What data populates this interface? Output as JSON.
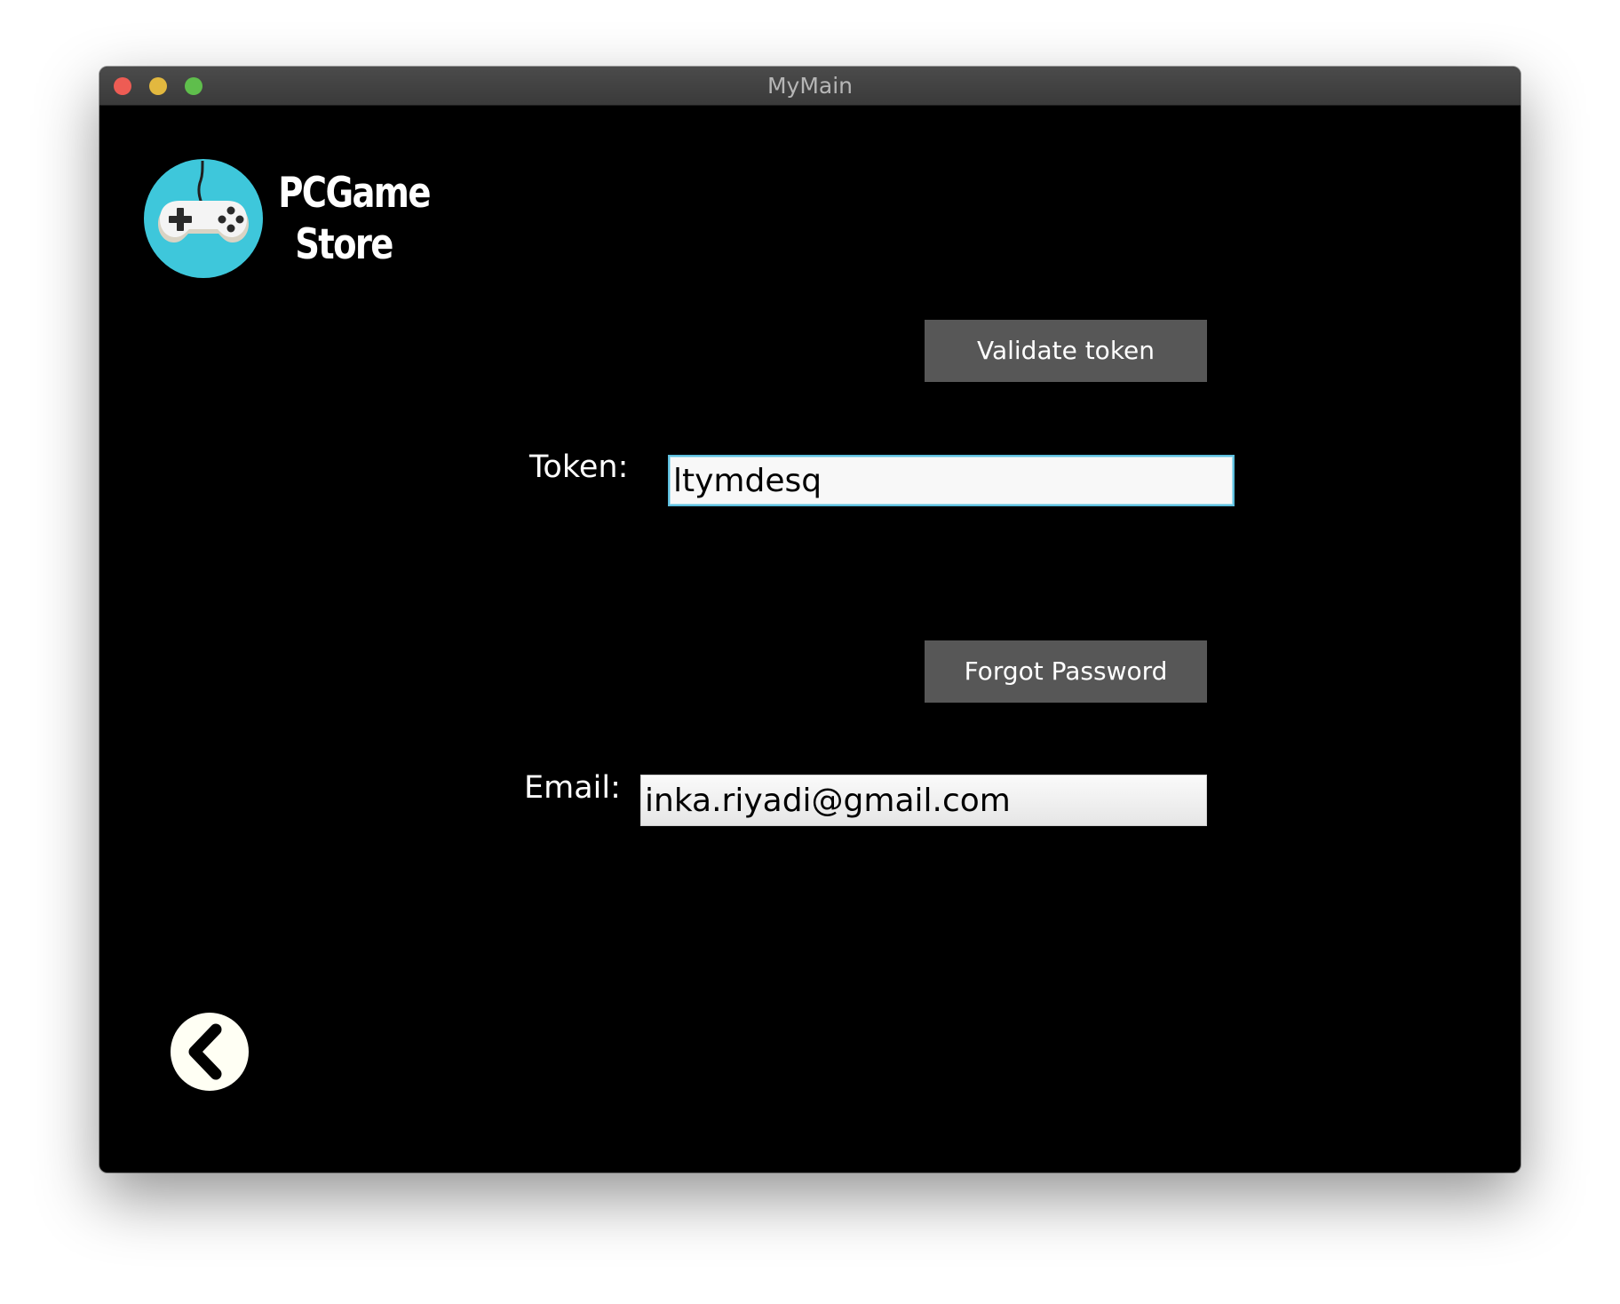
{
  "window": {
    "title": "MyMain"
  },
  "logo": {
    "line1": "PCGame",
    "line2": "Store",
    "icon": "gamepad-icon",
    "accent_color": "#3ec7db"
  },
  "token_section": {
    "validate_label": "Validate token",
    "token_label": "Token:",
    "token_value": "ltymdesq"
  },
  "email_section": {
    "forgot_label": "Forgot Password",
    "email_label": "Email:",
    "email_value": "inka.riyadi@gmail.com"
  },
  "navigation": {
    "back_icon": "chevron-left-icon"
  },
  "colors": {
    "background": "#000000",
    "button": "#575757",
    "focus_border": "#5ec0df"
  }
}
